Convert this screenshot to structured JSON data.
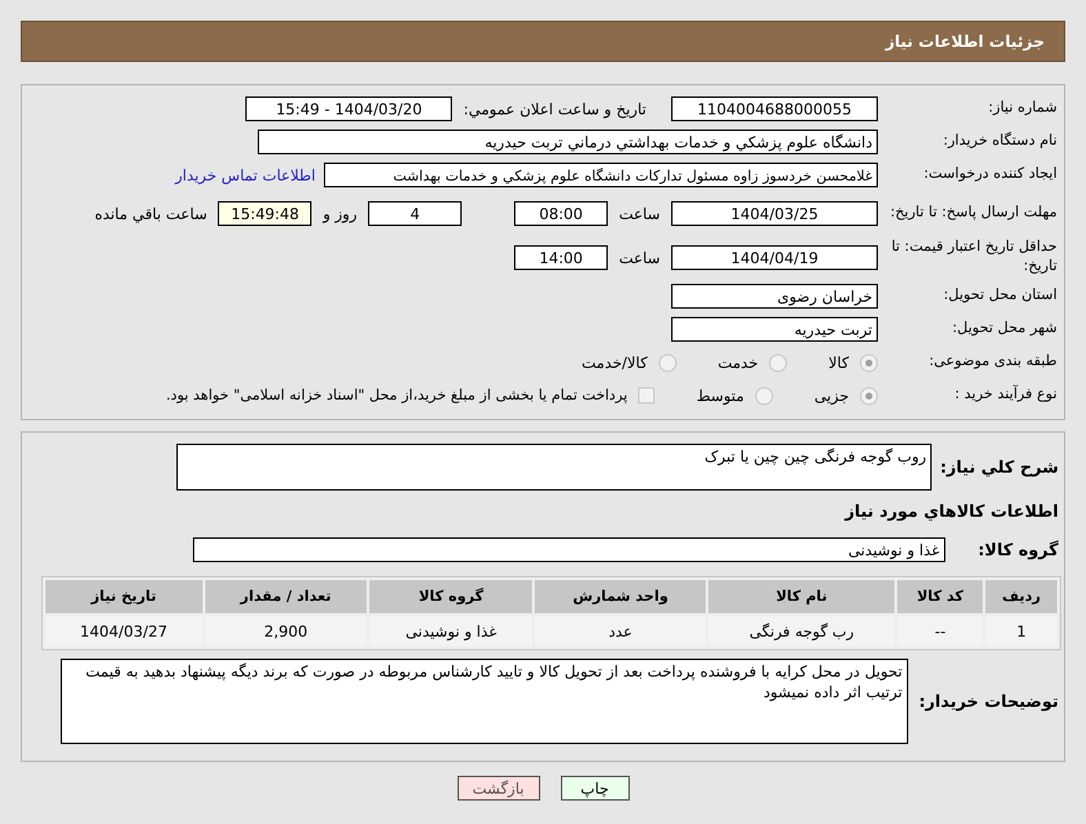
{
  "header": {
    "title": "جزئیات اطلاعات نیاز"
  },
  "details": {
    "need_number": {
      "label": "شماره نیاز:",
      "value": "1104004688000055"
    },
    "announce": {
      "label": "تاريخ و ساعت اعلان عمومي:",
      "value": "1404/03/20 - 15:49"
    },
    "buyer": {
      "label": "نام دستگاه خریدار:",
      "value": "دانشگاه علوم پزشكي و خدمات بهداشتي درماني تربت حيدريه"
    },
    "creator": {
      "label": "ایجاد کننده درخواست:",
      "value": "غلامحسن خردسوز زاوه مسئول تداركات دانشگاه علوم پزشكي و خدمات بهداشت",
      "link": "اطلاعات تماس خریدار"
    },
    "deadline": {
      "label": "مهلت ارسال پاسخ: تا تاریخ:",
      "date": "1404/03/25",
      "time_label": "ساعت",
      "time": "08:00",
      "days": "4",
      "days_label": "روز و",
      "remaining": "15:49:48",
      "remaining_label": "ساعت باقي مانده"
    },
    "validity": {
      "label": "حداقل تاریخ اعتبار قیمت: تا تاریخ:",
      "date": "1404/04/19",
      "time_label": "ساعت",
      "time": "14:00"
    },
    "province": {
      "label": "استان محل تحویل:",
      "value": "خراسان رضوی"
    },
    "city": {
      "label": "شهر محل تحویل:",
      "value": "تربت حیدریه"
    },
    "category": {
      "label": "طبقه بندی موضوعی:",
      "options": [
        {
          "label": "کالا",
          "selected": true
        },
        {
          "label": "خدمت",
          "selected": false
        },
        {
          "label": "کالا/خدمت",
          "selected": false
        }
      ]
    },
    "process": {
      "label": "نوع فرآیند خرید :",
      "options": [
        {
          "label": "جزیی",
          "selected": true
        },
        {
          "label": "متوسط",
          "selected": false
        }
      ],
      "payment": {
        "checked": false,
        "label": "پرداخت تمام یا بخشی از مبلغ خرید،از محل \"اسناد خزانه اسلامی\" خواهد بود."
      }
    }
  },
  "description": {
    "label": "شرح كلي نياز:",
    "value": "روب  گوجه فرنگی  چین چین یا تبرک"
  },
  "goods_title": "اطلاعات كالاهاي مورد نياز",
  "goods_group": {
    "label": "گروه کالا:",
    "value": "غذا و نوشیدنی"
  },
  "table": {
    "columns": [
      "ردیف",
      "کد کالا",
      "نام کالا",
      "واحد شمارش",
      "گروه کالا",
      "تعداد / مقدار",
      "تاریخ نیاز"
    ],
    "rows": [
      [
        "1",
        "--",
        "رب گوجه فرنگی",
        "عدد",
        "غذا و نوشیدنی",
        "2,900",
        "1404/03/27"
      ]
    ]
  },
  "buyer_notes": {
    "label": "توضیحات خریدار:",
    "value": "تحویل در محل کرایه با فروشنده پرداخت بعد از تحویل  کالا و تایید کارشناس مربوطه در صورت که برند دیگه پیشنهاد بدهید به قیمت ترتیب اثر داده نمیشود"
  },
  "buttons": [
    {
      "label": "چاپ",
      "kind": "print"
    },
    {
      "label": "بازگشت",
      "kind": "back"
    }
  ]
}
